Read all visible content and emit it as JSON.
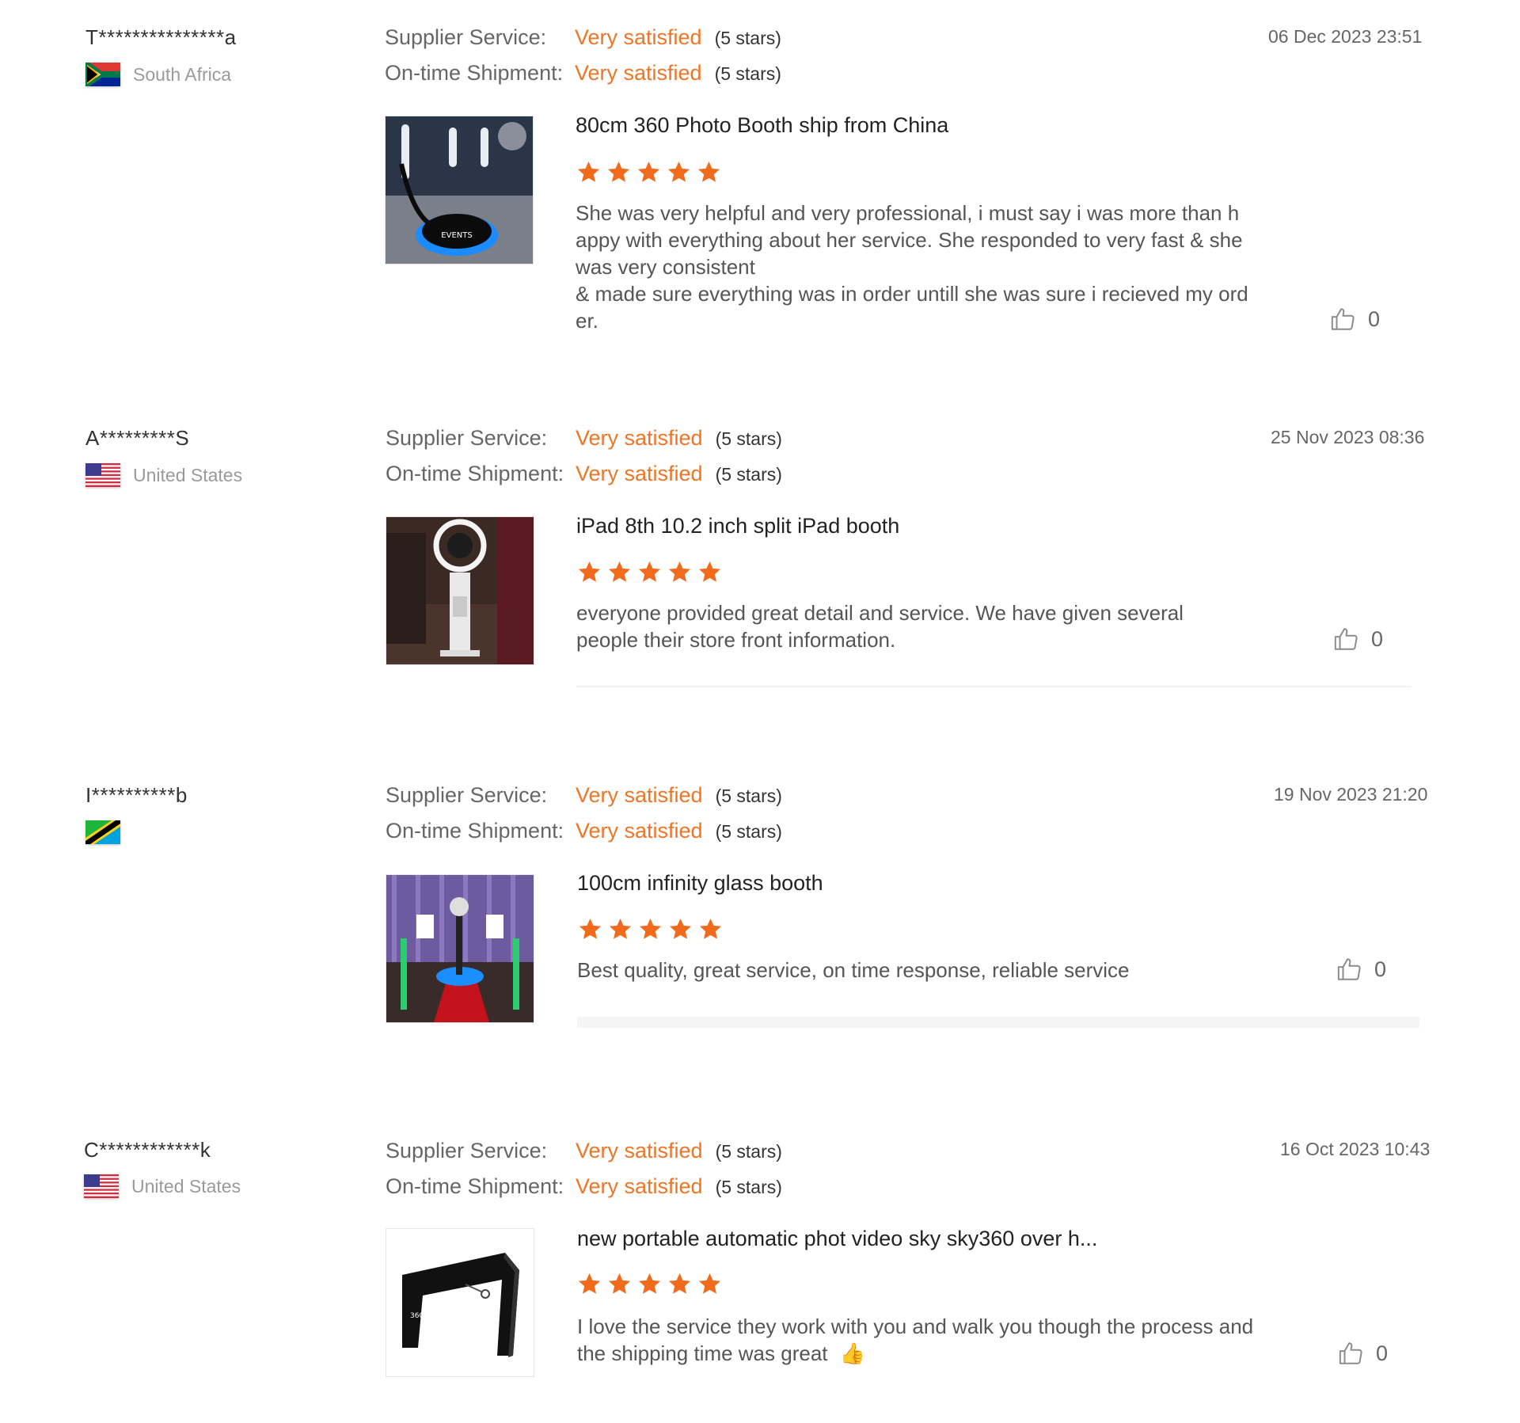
{
  "colors": {
    "accent": "#ee7526",
    "text": "#333333",
    "muted": "#9a9a9a"
  },
  "labels": {
    "supplier_service": "Supplier Service:",
    "ontime_shipment": "On-time Shipment:"
  },
  "reviews": [
    {
      "name": "T***************a",
      "country": "South Africa",
      "flag_icon": "south-africa-flag-icon",
      "supplier_service": "Very satisfied",
      "supplier_service_stars": "(5 stars)",
      "ontime_shipment": "Very satisfied",
      "ontime_shipment_stars": "(5 stars)",
      "date": "06 Dec 2023 23:51",
      "product_title": "80cm 360 Photo Booth ship from China",
      "rating": 5,
      "text": "She was very helpful and very professional, i must say i was more than happy with everything about her service. She responded to very fast & she was very consistent\n& made sure everything was in order untill she was sure i recieved my order.",
      "likes": "0",
      "image_icon": "photo-booth-360-image"
    },
    {
      "name": "A*********S",
      "country": "United States",
      "flag_icon": "united-states-flag-icon",
      "supplier_service": "Very satisfied",
      "supplier_service_stars": "(5 stars)",
      "ontime_shipment": "Very satisfied",
      "ontime_shipment_stars": "(5 stars)",
      "date": "25 Nov 2023 08:36",
      "product_title": "iPad 8th 10.2 inch split iPad booth",
      "rating": 5,
      "text": "everyone provided great detail and service.  We have given several people their store front information.",
      "likes": "0",
      "image_icon": "ipad-booth-image"
    },
    {
      "name": "I**********b",
      "country": "",
      "flag_icon": "tanzania-flag-icon",
      "supplier_service": "Very satisfied",
      "supplier_service_stars": "(5 stars)",
      "ontime_shipment": "Very satisfied",
      "ontime_shipment_stars": "(5 stars)",
      "date": "19 Nov 2023 21:20",
      "product_title": "100cm infinity glass booth",
      "rating": 5,
      "text": "Best quality, great service, on time response, reliable service",
      "likes": "0",
      "image_icon": "infinity-glass-booth-image"
    },
    {
      "name": "C************k",
      "country": "United States",
      "flag_icon": "united-states-flag-icon",
      "supplier_service": "Very satisfied",
      "supplier_service_stars": "(5 stars)",
      "ontime_shipment": "Very satisfied",
      "ontime_shipment_stars": "(5 stars)",
      "date": "16 Oct 2023 10:43",
      "product_title": "new portable automatic phot video sky sky360 over h...",
      "rating": 5,
      "text": "I love the service they work with you and walk you though the process and the shipping time was great",
      "text_emoji": "👍",
      "likes": "0",
      "image_icon": "portable-sky360-booth-image"
    }
  ]
}
